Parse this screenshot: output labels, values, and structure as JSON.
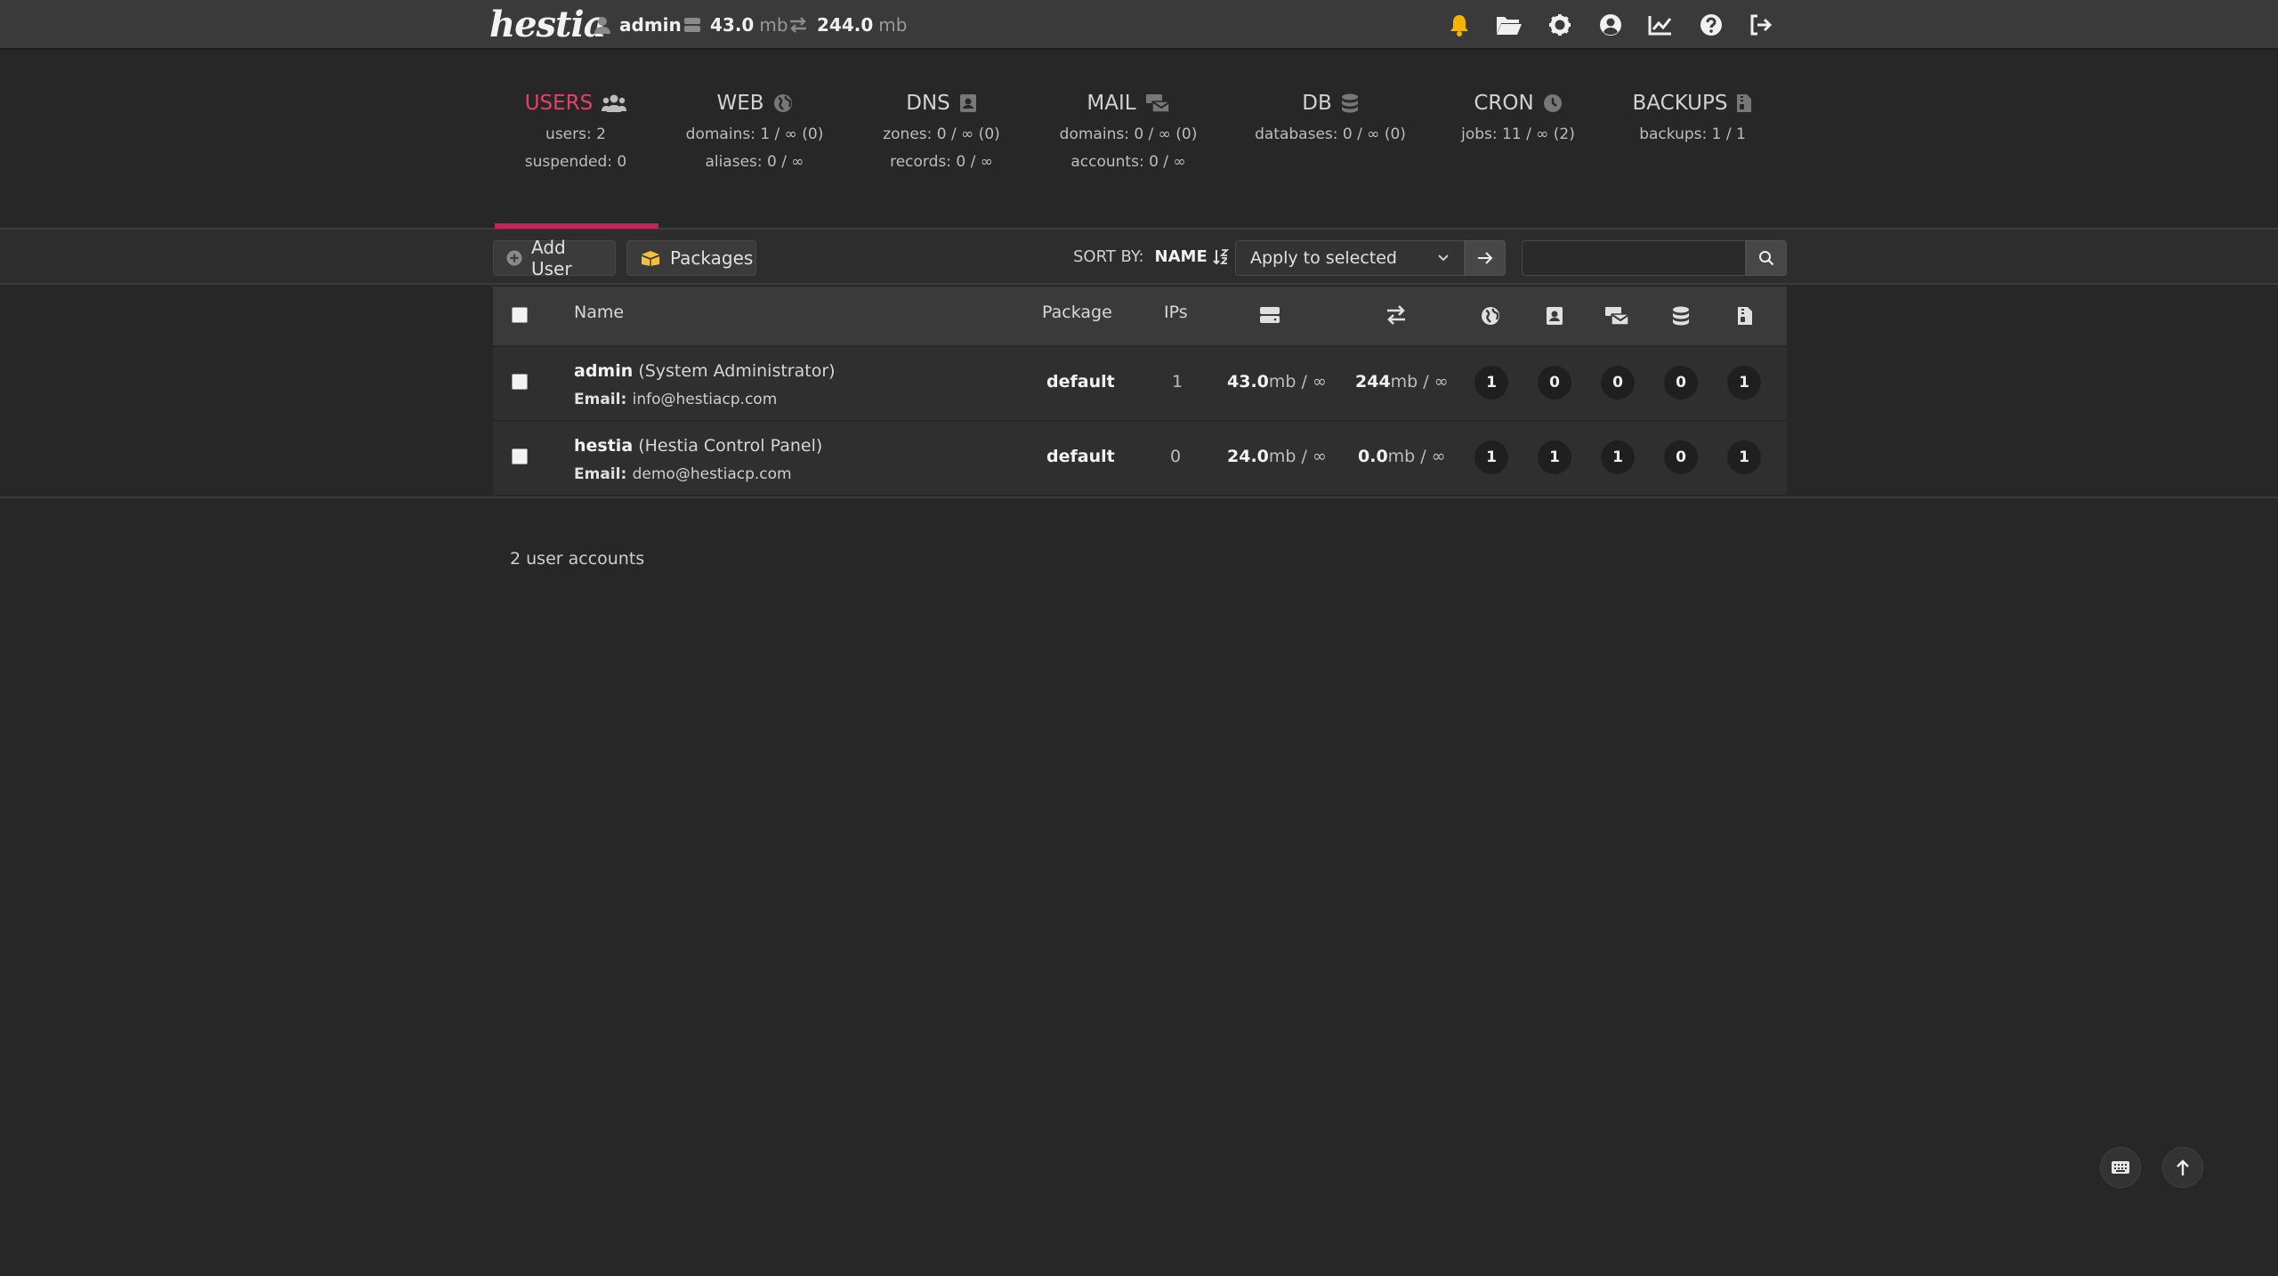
{
  "topbar": {
    "logo": "hestia",
    "user": "admin",
    "disk_value": "43.0",
    "disk_unit": "mb",
    "bandwidth_value": "244.0",
    "bandwidth_unit": "mb"
  },
  "stats": [
    {
      "title": "USERS",
      "line1": "users: 2",
      "line2": "suspended: 0"
    },
    {
      "title": "WEB",
      "line1": "domains: 1 / ∞ (0)",
      "line2": "aliases: 0 / ∞"
    },
    {
      "title": "DNS",
      "line1": "zones: 0 / ∞ (0)",
      "line2": "records: 0 / ∞"
    },
    {
      "title": "MAIL",
      "line1": "domains: 0 / ∞ (0)",
      "line2": "accounts: 0 / ∞"
    },
    {
      "title": "DB",
      "line1": "databases: 0 / ∞ (0)",
      "line2": ""
    },
    {
      "title": "CRON",
      "line1": "jobs: 11 / ∞ (2)",
      "line2": ""
    },
    {
      "title": "BACKUPS",
      "line1": "backups: 1 / 1",
      "line2": ""
    }
  ],
  "toolbar": {
    "add_user": "Add User",
    "packages": "Packages",
    "sort_by": "SORT BY:",
    "sort_field": "NAME",
    "bulk_action": "Apply to selected",
    "search_placeholder": ""
  },
  "table": {
    "headers": {
      "name": "Name",
      "package": "Package",
      "ips": "IPs"
    },
    "email_label": "Email:",
    "rows": [
      {
        "username": "admin",
        "fullname": "(System Administrator)",
        "email": "info@hestiacp.com",
        "package": "default",
        "ips": "1",
        "disk": "43.0",
        "disk_unit": "mb / ∞",
        "bandwidth": "244",
        "bandwidth_unit": "mb / ∞",
        "web": "1",
        "dns": "0",
        "mail": "0",
        "db": "0",
        "backups": "1"
      },
      {
        "username": "hestia",
        "fullname": "(Hestia Control Panel)",
        "email": "demo@hestiacp.com",
        "package": "default",
        "ips": "0",
        "disk": "24.0",
        "disk_unit": "mb / ∞",
        "bandwidth": "0.0",
        "bandwidth_unit": "mb / ∞",
        "web": "1",
        "dns": "1",
        "mail": "1",
        "db": "0",
        "backups": "1"
      }
    ]
  },
  "footer": {
    "count": "2 user accounts"
  },
  "colors": {
    "accent": "#e43f6f",
    "bell": "#f5b400",
    "folder": "#f3c13a",
    "background": "#272727"
  }
}
